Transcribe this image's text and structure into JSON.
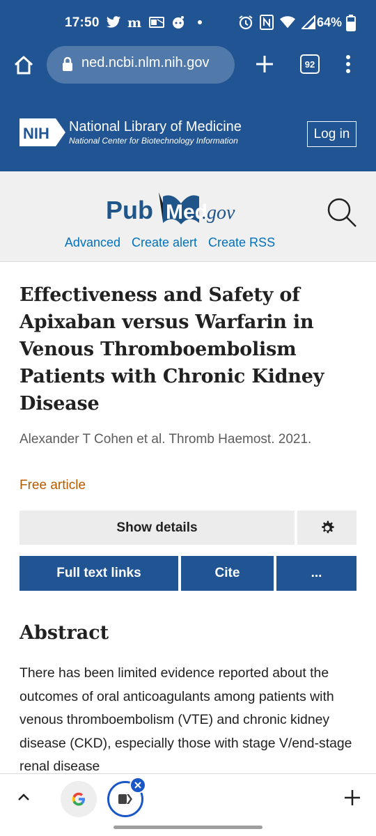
{
  "status_bar": {
    "time": "17:50",
    "battery": "64%",
    "left_icons": [
      "twitter-icon",
      "m-app-icon",
      "outlook-icon",
      "reddit-icon",
      "dot-icon"
    ],
    "right_icons": [
      "alarm-icon",
      "nfc-icon",
      "wifi-icon",
      "signal-icon",
      "battery-icon"
    ]
  },
  "browser": {
    "url": "ned.ncbi.nlm.nih.gov",
    "tab_count": "92"
  },
  "nih": {
    "badge": "NIH",
    "title": "National Library of Medicine",
    "subtitle": "National Center for Biotechnology Information",
    "login": "Log in"
  },
  "pubmed": {
    "logo_pub": "Pub",
    "logo_med": "Med",
    "logo_gov": ".gov",
    "links": [
      "Advanced",
      "Create alert",
      "Create RSS"
    ]
  },
  "article": {
    "title": "Effectiveness and Safety of Apixaban versus Warfarin in Venous Thromboembolism Patients with Chronic Kidney Disease",
    "citation": "Alexander T Cohen et al. Thromb Haemost. 2021.",
    "free_label": "Free article",
    "show_details": "Show details",
    "full_text": "Full text links",
    "cite": "Cite",
    "more": "...",
    "abstract_heading": "Abstract",
    "abstract_text": "There has been limited evidence reported about the outcomes of oral anticoagulants among patients with venous thromboembolism (VTE) and chronic kidney disease (CKD), especially those with stage V/end-stage renal disease"
  },
  "colors": {
    "nih_blue": "#205493",
    "link_blue": "#0071bc",
    "free_orange": "#b65a00"
  }
}
